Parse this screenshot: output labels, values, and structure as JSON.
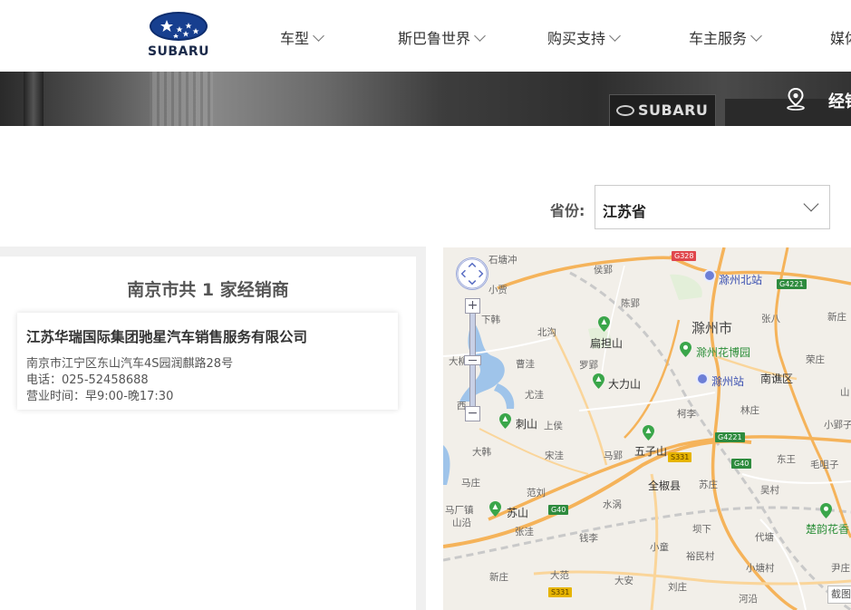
{
  "brand": {
    "name": "SUBARU"
  },
  "nav": {
    "items": [
      {
        "label": "车型"
      },
      {
        "label": "斯巴鲁世界"
      },
      {
        "label": "购买支持"
      },
      {
        "label": "车主服务"
      },
      {
        "label": "媒体"
      }
    ]
  },
  "banner": {
    "title": "经销商查询",
    "sign_text": "SUBARU"
  },
  "province": {
    "label": "省份:",
    "value": "江苏省"
  },
  "dealers": {
    "summary": "南京市共 1 家经销商",
    "list": [
      {
        "name": "江苏华瑞国际集团驰星汽车销售服务有限公司",
        "address": "南京市江宁区东山汽车4S园润麒路28号",
        "phone": "电话：025-52458688",
        "hours": "营业时间：早9:00-晚17:30"
      }
    ]
  },
  "map": {
    "controls": {
      "zoom_in": "+",
      "zoom_out": "−",
      "screenshot": "截图"
    },
    "labels": {
      "chuzhou": "滁州市",
      "nanqiao": "南谯区",
      "quanjiao": "全椒县",
      "shitangchong": "石塘冲",
      "houying": "侯郢",
      "xiaojia": "小贾",
      "xiahan": "下韩",
      "beigou": "北沟",
      "chenying": "陈郢",
      "zhangba": "张八",
      "xinzhuang": "新庄",
      "daliu": "大柳",
      "caowa": "曹洼",
      "luoying": "罗郢",
      "youwa": "尤洼",
      "rongzhuang": "荣庄",
      "shanxiang": "山",
      "xi": "西",
      "kexi": "柯李",
      "linzhuang": "林庄",
      "xiaoliying": "小郢子",
      "shangbao": "上侯",
      "songwa": "宋洼",
      "maying": "马郢",
      "dahan": "大韩",
      "mazhuang": "马庄",
      "fanliu": "范刘",
      "suzhuang": "苏庄",
      "maochong": "毛咀子",
      "dongwang": "东王",
      "wucun": "吴村",
      "shuiwo": "水涡",
      "machang": "马厂镇",
      "shanyan": "山沿",
      "zhangwa": "张洼",
      "qianli": "钱李",
      "fengxia": "坝下",
      "daixin": "代塘",
      "xiaotong": "小童",
      "yumin": "裕民村",
      "xiaotangcun": "小塘村",
      "xinzhuang2": "新庄",
      "dafan": "大范",
      "daan": "大安",
      "liuzhuang": "刘庄",
      "hexi": "河沿",
      "yinzhuang": "尹庄"
    },
    "pois": {
      "biandan": "扁担山",
      "dali": "大力山",
      "ci": "刺山",
      "wuzi": "五子山",
      "su": "苏山",
      "huabo": "滁州花博园",
      "chuyun": "楚韵花香"
    },
    "stations": {
      "north": "滁州北站",
      "main": "滁州站"
    },
    "shields": {
      "g328": "G328",
      "g4221a": "G4221",
      "g4221b": "G4221",
      "g40a": "G40",
      "g40b": "G40",
      "s331a": "S331",
      "s331b": "S331"
    }
  },
  "colors": {
    "accent": "#2d8f3a",
    "station": "#6d7fd6",
    "road": "#f5b35a"
  }
}
